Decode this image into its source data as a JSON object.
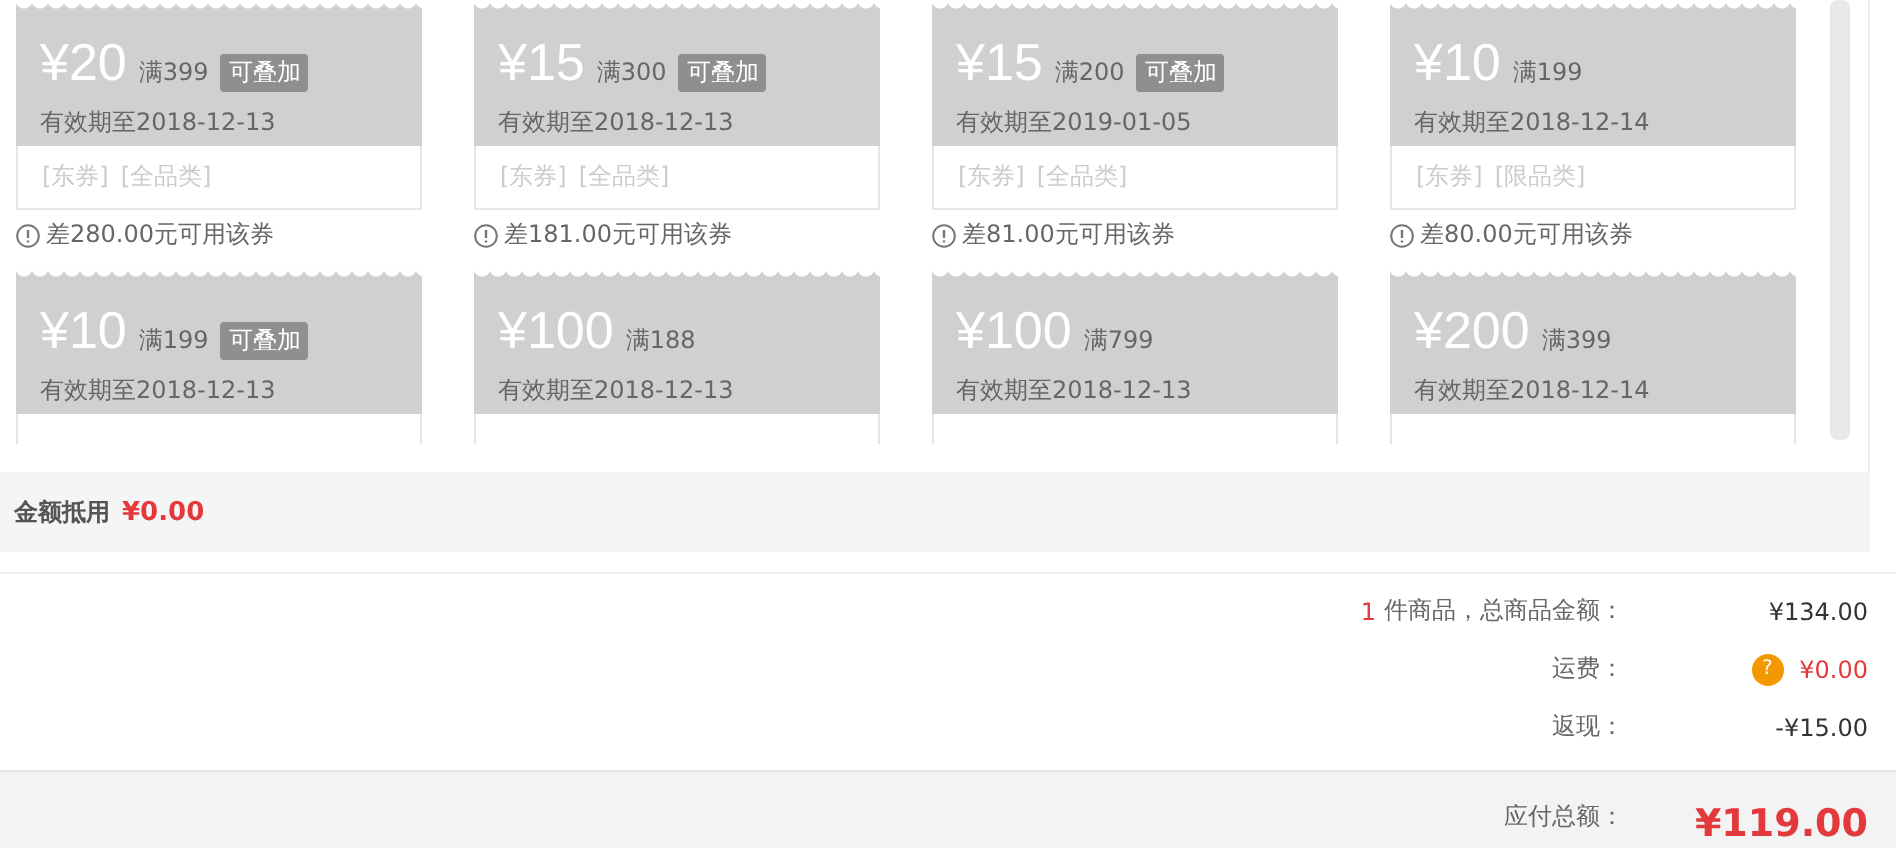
{
  "coupons": [
    {
      "amount": "¥20",
      "condition": "满399",
      "badge": "可叠加",
      "validity": "有效期至2018-12-13",
      "tags": [
        "[东券]",
        "[全品类]"
      ],
      "note": "差280.00元可用该券"
    },
    {
      "amount": "¥15",
      "condition": "满300",
      "badge": "可叠加",
      "validity": "有效期至2018-12-13",
      "tags": [
        "[东券]",
        "[全品类]"
      ],
      "note": "差181.00元可用该券"
    },
    {
      "amount": "¥15",
      "condition": "满200",
      "badge": "可叠加",
      "validity": "有效期至2019-01-05",
      "tags": [
        "[东券]",
        "[全品类]"
      ],
      "note": "差81.00元可用该券"
    },
    {
      "amount": "¥10",
      "condition": "满199",
      "validity": "有效期至2018-12-14",
      "tags": [
        "[东券]",
        "[限品类]"
      ],
      "note": "差80.00元可用该券"
    },
    {
      "amount": "¥10",
      "condition": "满199",
      "badge": "可叠加",
      "validity": "有效期至2018-12-13"
    },
    {
      "amount": "¥100",
      "condition": "满188",
      "validity": "有效期至2018-12-13"
    },
    {
      "amount": "¥100",
      "condition": "满799",
      "validity": "有效期至2018-12-13"
    },
    {
      "amount": "¥200",
      "condition": "满399",
      "validity": "有效期至2018-12-14"
    }
  ],
  "discount": {
    "label": "金额抵用",
    "value": "¥0.00"
  },
  "summary": [
    {
      "count": "1",
      "label": "件商品，总商品金额：",
      "value": "¥134.00",
      "highlight": false
    },
    {
      "label": "运费：",
      "help": "?",
      "value": "¥0.00",
      "highlight": true
    },
    {
      "label": "返现：",
      "value": "-¥15.00",
      "highlight": false
    }
  ],
  "total": {
    "label": "应付总额：",
    "value": "¥119.00"
  }
}
